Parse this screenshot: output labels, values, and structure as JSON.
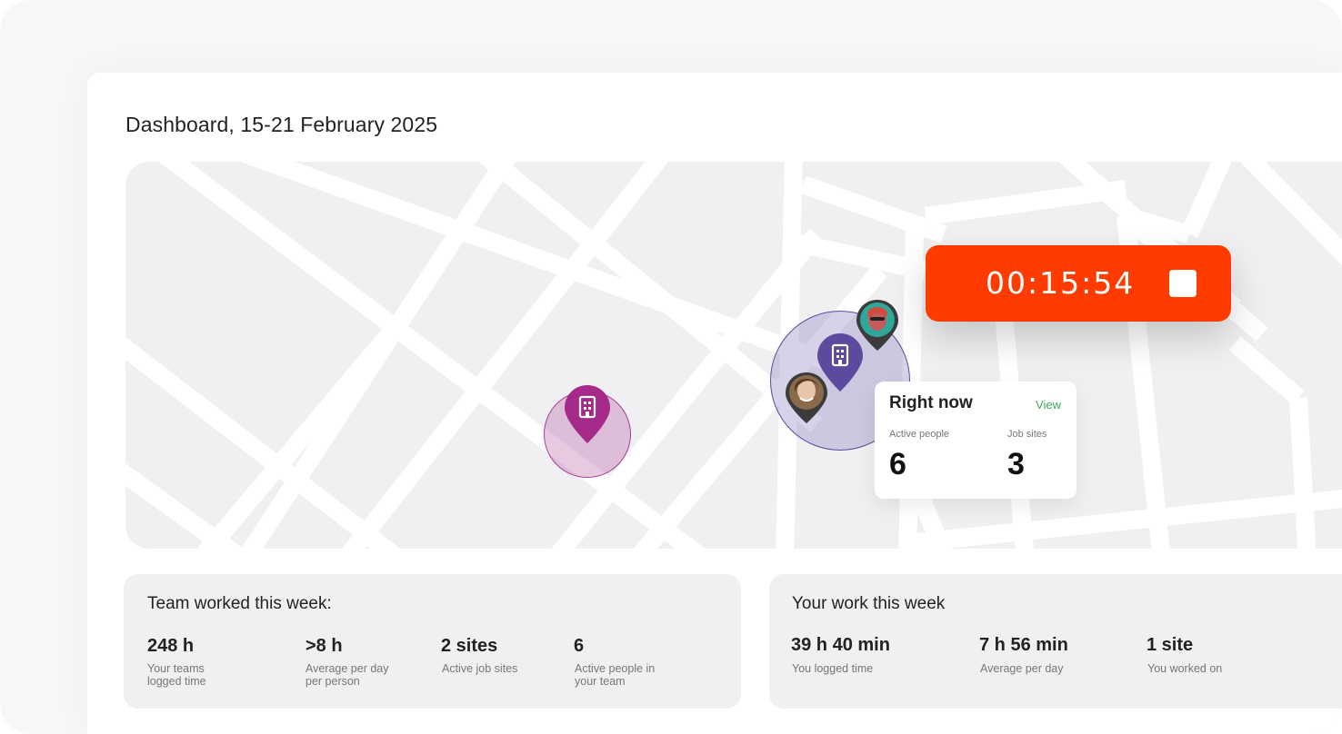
{
  "page": {
    "title": "Dashboard, 15-21 February 2025"
  },
  "timer": {
    "elapsed": "00:15:54"
  },
  "right_now": {
    "title": "Right now",
    "view_link": "View",
    "active_people_label": "Active people",
    "active_people_value": "6",
    "job_sites_label": "Job sites",
    "job_sites_value": "3"
  },
  "team_card": {
    "title": "Team worked this week:",
    "stats": [
      {
        "value": "248 h",
        "label_line1": "Your teams",
        "label_line2": "logged time"
      },
      {
        "value": ">8 h",
        "label_line1": "Average per day",
        "label_line2": "per person"
      },
      {
        "value": "2 sites",
        "label_line1": "Active job sites",
        "label_line2": ""
      },
      {
        "value": "6",
        "label_line1": "Active people in",
        "label_line2": "your team"
      }
    ]
  },
  "your_card": {
    "title": "Your work this week",
    "stats": [
      {
        "value": "39 h 40 min",
        "label_line1": "You logged time"
      },
      {
        "value": "7 h 56 min",
        "label_line1": "Average per day"
      },
      {
        "value": "1 site",
        "label_line1": "You worked on"
      }
    ]
  },
  "colors": {
    "timer_bg": "#ff3b00",
    "magenta_pin": "#a52a8a",
    "purple_pin": "#5b4a9e",
    "view_link": "#3aa757"
  },
  "icons": [
    "building-icon",
    "stop-icon",
    "location-pin-icon",
    "avatar"
  ]
}
